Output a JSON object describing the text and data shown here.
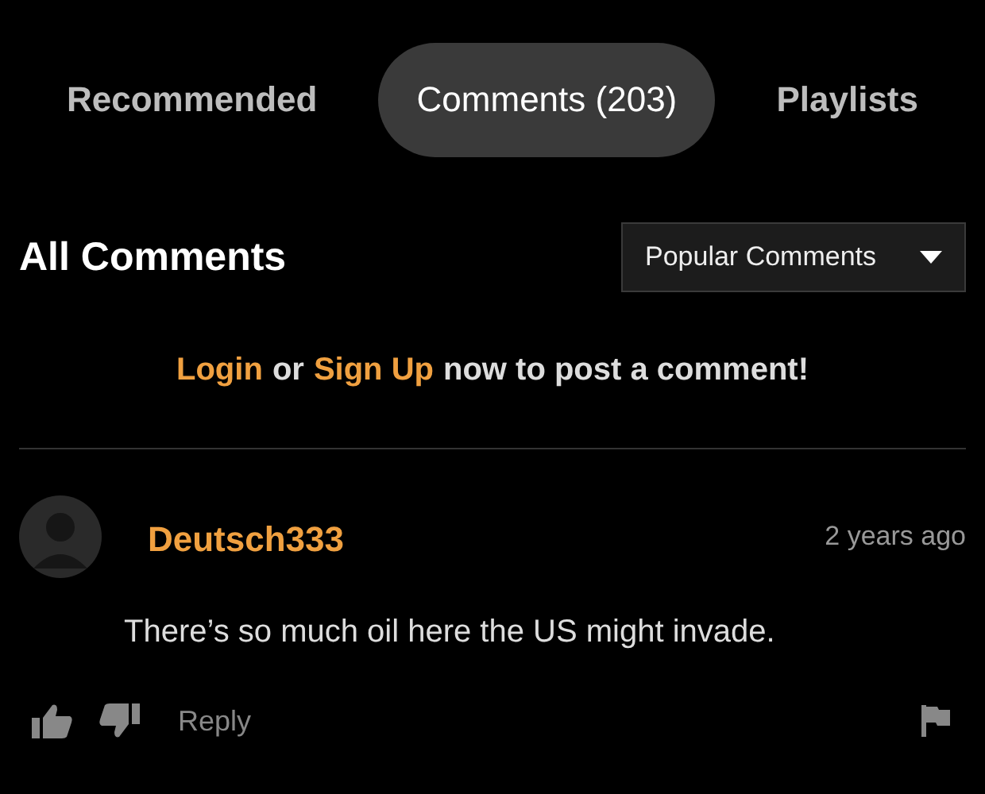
{
  "tabs": [
    {
      "label": "Recommended",
      "selected": false
    },
    {
      "label": "Comments (203)",
      "selected": true
    },
    {
      "label": "Playlists",
      "selected": false
    }
  ],
  "section_title": "All Comments",
  "sort_dropdown": {
    "value": "Popular Comments"
  },
  "login_prompt": {
    "login": "Login",
    "or": "or",
    "signup": "Sign Up",
    "rest": "now to post a comment!"
  },
  "comments": [
    {
      "user": "Deutsch333",
      "time": "2 years ago",
      "text": "There’s so much oil here the US might invade.",
      "reply": "Reply"
    }
  ]
}
